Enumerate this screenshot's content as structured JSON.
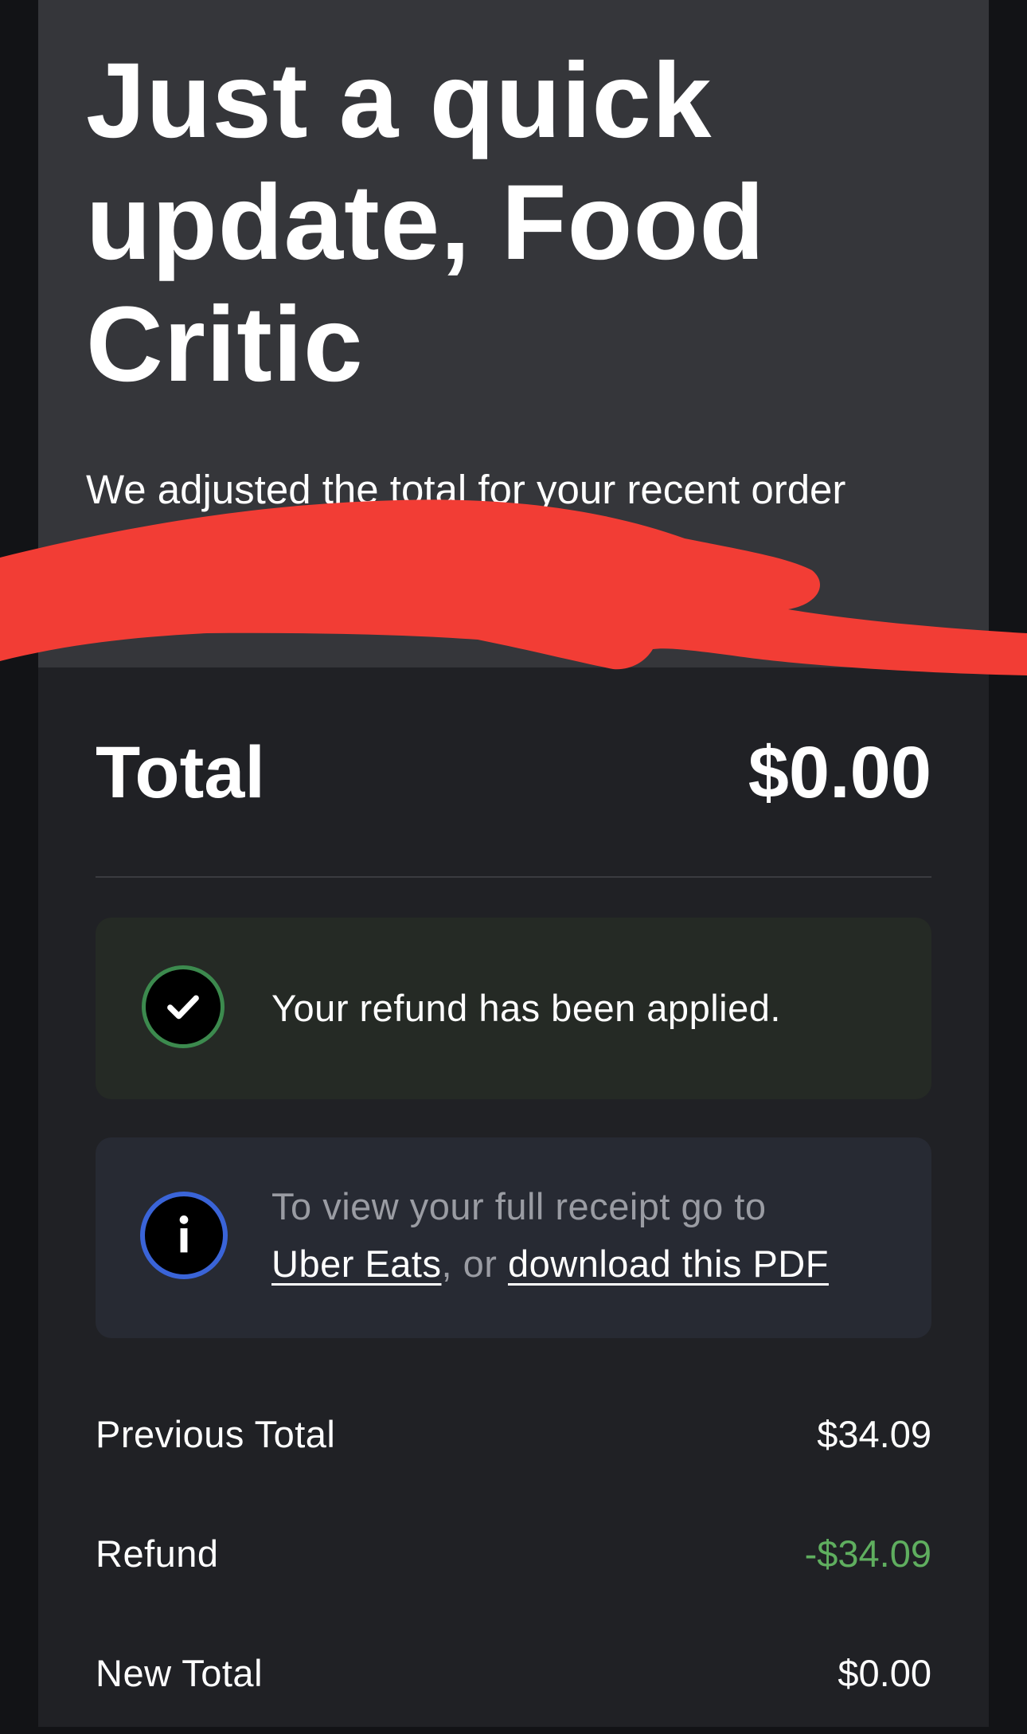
{
  "header": {
    "headline": "Just a quick update, Food Critic",
    "subtitle": "We adjusted the total for your recent order"
  },
  "summary": {
    "total_label": "Total",
    "total_value": "$0.00"
  },
  "refund_notice": {
    "message": "Your refund has been applied.",
    "icon": "check-circle-icon"
  },
  "receipt_notice": {
    "text_prefix": "To view your full receipt go to",
    "link_uber_eats": "Uber Eats",
    "separator": ", or",
    "link_pdf": "download this PDF",
    "icon": "info-circle-icon"
  },
  "breakdown": [
    {
      "label": "Previous Total",
      "value": "$34.09"
    },
    {
      "label": "Refund",
      "value": "-$34.09"
    },
    {
      "label": "New Total",
      "value": "$0.00"
    }
  ],
  "colors": {
    "background": "#121316",
    "card": "#202125",
    "hero": "#35363a",
    "success_panel": "#252a25",
    "info_panel": "#272a33",
    "success_ring": "#3c8a4e",
    "info_ring": "#3a64d8",
    "refund_amount": "#5fae5f",
    "redaction": "#f23d35"
  }
}
